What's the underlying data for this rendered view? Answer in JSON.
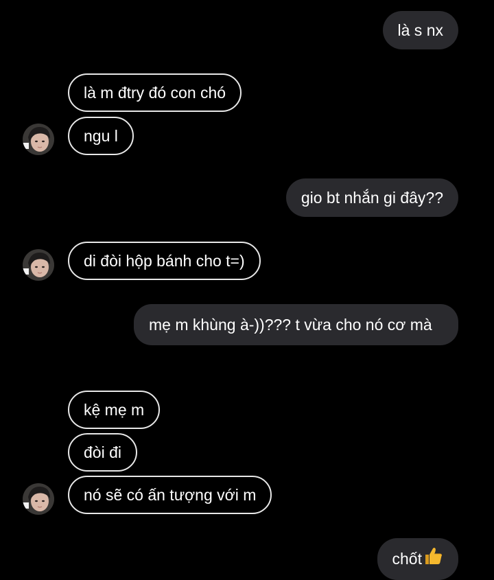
{
  "conversation": {
    "messages": [
      {
        "sender": "me",
        "text": "là s nx"
      },
      {
        "sender": "them",
        "text": "là m đtry đó con chó"
      },
      {
        "sender": "them",
        "text": "ngu l"
      },
      {
        "sender": "me",
        "text": "gio bt nhắn gi đây??"
      },
      {
        "sender": "them",
        "text": "di đòi hộp bánh cho t=)"
      },
      {
        "sender": "me",
        "text": "mẹ m khùng à-))??? t vừa cho nó cơ mà"
      },
      {
        "sender": "them",
        "text": "kệ mẹ m"
      },
      {
        "sender": "them",
        "text": "đòi đi"
      },
      {
        "sender": "them",
        "text": "nó sẽ có ấn tượng với m"
      },
      {
        "sender": "me",
        "text": "chốt",
        "emoji": "thumbs-up-icon"
      }
    ]
  },
  "colors": {
    "background": "#000000",
    "outgoing_bubble": "#2a2a2e",
    "incoming_border": "#e8e8e8",
    "text": "#ffffff",
    "thumbs_up": "#f5b82e"
  }
}
